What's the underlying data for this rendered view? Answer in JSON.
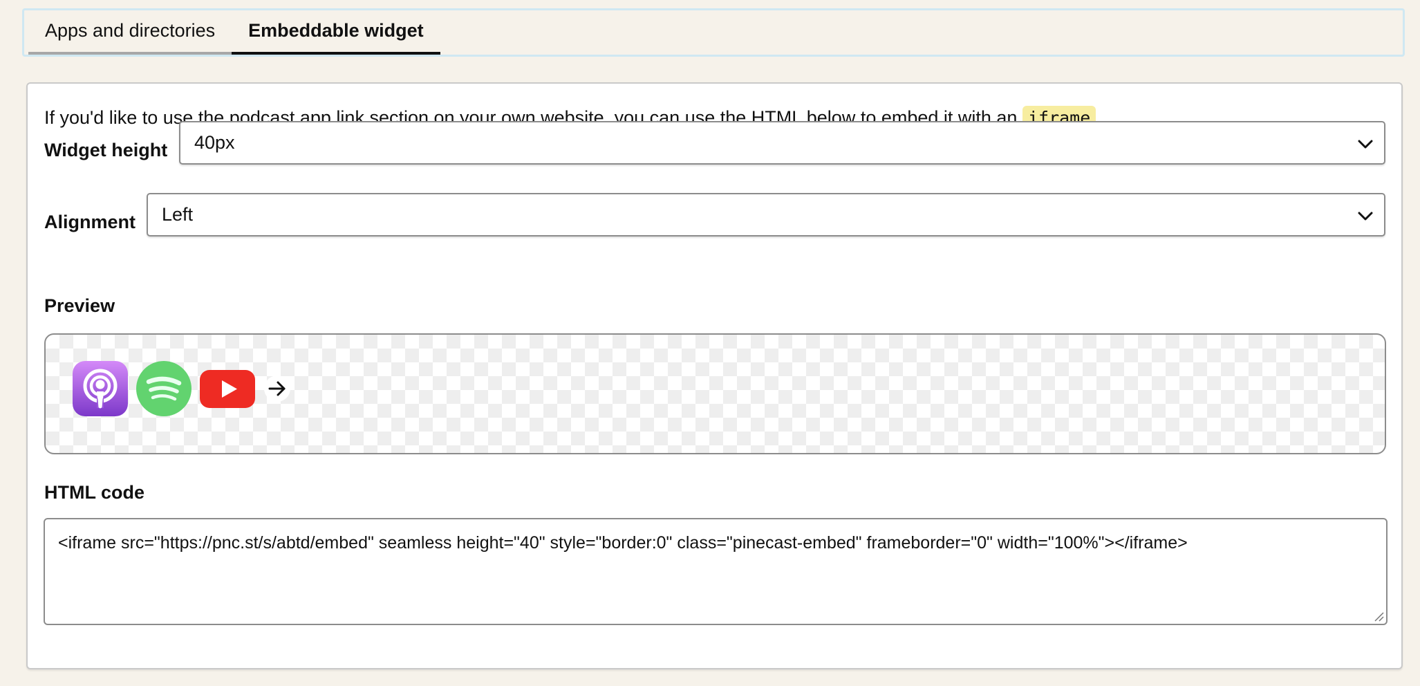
{
  "tabs": [
    {
      "label": "Apps and directories",
      "active": false
    },
    {
      "label": "Embeddable widget",
      "active": true
    }
  ],
  "intro": {
    "text_before": "If you'd like to use the podcast app link section on your own website, you can use the HTML below to embed it with an",
    "code": "iframe",
    "text_after": "."
  },
  "widget_height": {
    "label": "Widget height",
    "value": "40px"
  },
  "alignment": {
    "label": "Alignment",
    "value": "Left"
  },
  "preview": {
    "label": "Preview",
    "apps": [
      {
        "name": "apple-podcasts-icon",
        "color": "#9b4fd9"
      },
      {
        "name": "spotify-icon",
        "color": "#62d36f"
      },
      {
        "name": "youtube-icon",
        "color": "#ee2b23"
      },
      {
        "name": "arrow-right-icon",
        "color": "#111111"
      }
    ]
  },
  "html_code": {
    "label": "HTML code",
    "value": "<iframe src=\"https://pnc.st/s/abtd/embed\" seamless height=\"40\" style=\"border:0\" class=\"pinecast-embed\" frameborder=\"0\" width=\"100%\"></iframe>"
  },
  "colors": {
    "page_background": "#f6f2ea",
    "tab_border_accent": "#cfe8f2",
    "code_chip_background": "#f7eda0"
  }
}
